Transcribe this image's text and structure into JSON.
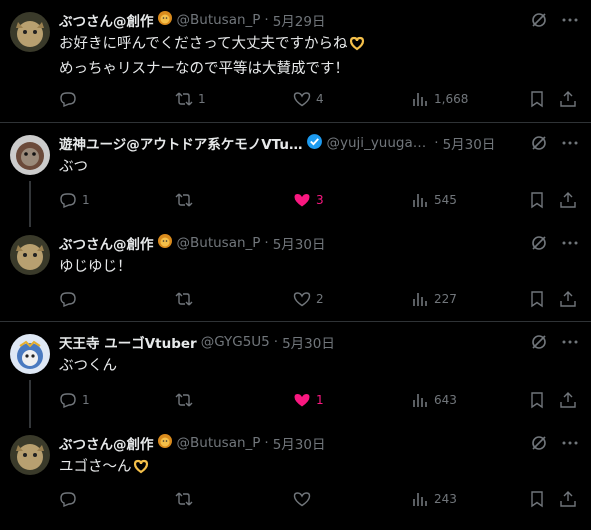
{
  "tweets": [
    {
      "name": "ぶつさん@創作",
      "handle": "@Butusan_P",
      "dot": "·",
      "date": "5月29日",
      "lines": [
        "お好きに呼んでくださって大丈夫ですからね",
        "めっちゃリスナーなので平等は大賛成です！"
      ],
      "emoji": "heart-hands",
      "reply": "",
      "retweet": "1",
      "like": "4",
      "liked": false,
      "views": "1,668"
    },
    {
      "name": "遊神ユージ@アウトドア系ケモノVTu…",
      "handle": "@yuji_yuuga…",
      "dot": "·",
      "date": "5月30日",
      "lines": [
        "ぶつ"
      ],
      "emoji": "",
      "reply": "1",
      "retweet": "",
      "like": "3",
      "liked": true,
      "views": "545",
      "verified": true
    },
    {
      "name": "ぶつさん@創作",
      "handle": "@Butusan_P",
      "dot": "·",
      "date": "5月30日",
      "lines": [
        "ゆじゆじ！"
      ],
      "emoji": "",
      "reply": "",
      "retweet": "",
      "like": "2",
      "liked": false,
      "views": "227"
    },
    {
      "name": "天王寺 ユーゴVtuber",
      "handle": "@GYG5U5",
      "dot": "·",
      "date": "5月30日",
      "lines": [
        "ぶつくん"
      ],
      "emoji": "",
      "reply": "1",
      "retweet": "",
      "like": "1",
      "liked": true,
      "views": "643"
    },
    {
      "name": "ぶつさん@創作",
      "handle": "@Butusan_P",
      "dot": "·",
      "date": "5月30日",
      "lines": [
        "ユゴさ〜ん"
      ],
      "emoji": "heart-hands",
      "reply": "",
      "retweet": "",
      "like": "",
      "liked": false,
      "views": "243"
    }
  ],
  "colors": {
    "background": "#000000",
    "text": "#e7e9ea",
    "muted": "#71767b",
    "like": "#f91880",
    "verified": "#1d9bf0"
  }
}
